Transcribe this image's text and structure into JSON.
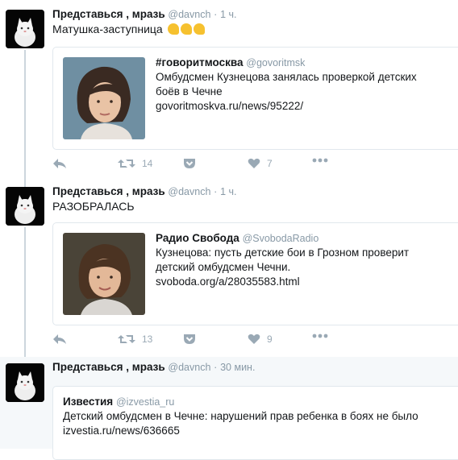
{
  "tweets": [
    {
      "author": "Представься , мразь",
      "handle": "@davnch",
      "dot": "·",
      "time": "1 ч.",
      "text": "Матушка-заступница",
      "emoji": "💪💪💪",
      "quote": {
        "author": "#говоритмосква",
        "handle": "@govoritmsk",
        "text_line1": "Омбудсмен Кузнецова занялась проверкой детских",
        "text_line2": "боёв в Чечне",
        "link": "govoritmoskva.ru/news/95222/"
      },
      "actions": {
        "retweets": "14",
        "likes": "7"
      }
    },
    {
      "author": "Представься , мразь",
      "handle": "@davnch",
      "dot": "·",
      "time": "1 ч.",
      "text": "РАЗОБРАЛАСЬ",
      "quote": {
        "author": "Радио Свобода",
        "handle": "@SvobodaRadio",
        "text_line1": "Кузнецова: пусть детские бои в Грозном проверит",
        "text_line2": "детский омбудсмен Чечни.",
        "link": "svoboda.org/a/28035583.html"
      },
      "actions": {
        "retweets": "13",
        "likes": "9"
      }
    },
    {
      "author": "Представься , мразь",
      "handle": "@davnch",
      "dot": "·",
      "time": "30 мин.",
      "quote": {
        "author": "Известия",
        "handle": "@izvestia_ru",
        "text_line1": "Детский омбудсмен в Чечне: нарушений прав ребенка в боях не было",
        "link": "izvestia.ru/news/636665"
      }
    }
  ],
  "colors": {
    "muted": "#8899a6",
    "icon": "#9aa9b5",
    "border": "#e1e8ed",
    "thread": "#ccd6dd"
  }
}
